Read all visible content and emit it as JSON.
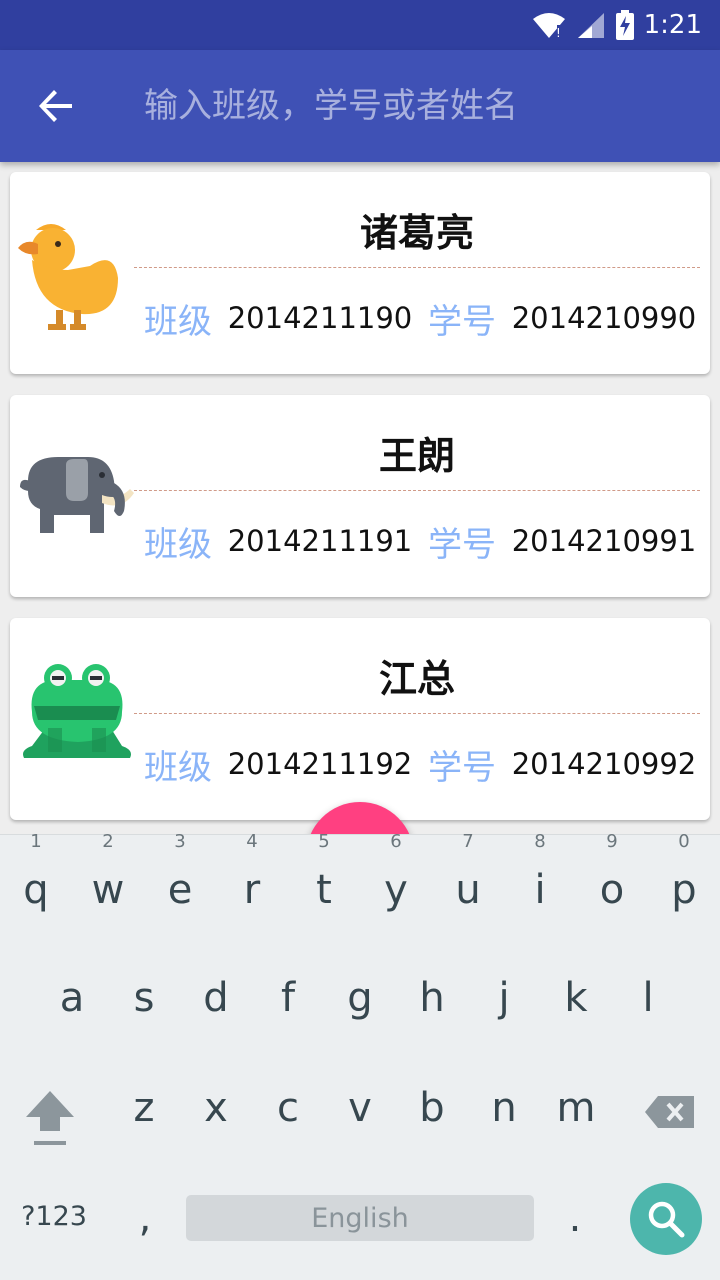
{
  "status_bar": {
    "time": "1:21",
    "icons": [
      "wifi-icon",
      "signal-icon",
      "battery-charging-icon"
    ]
  },
  "app_bar": {
    "back_icon": "arrow-back-icon",
    "search_placeholder": "输入班级，学号或者姓名"
  },
  "students": [
    {
      "name": "诸葛亮",
      "class_label": "班级",
      "class_value": "2014211190",
      "id_label": "学号",
      "id_value": "2014210990",
      "avatar": "duck-icon"
    },
    {
      "name": "王朗",
      "class_label": "班级",
      "class_value": "2014211191",
      "id_label": "学号",
      "id_value": "2014210991",
      "avatar": "elephant-icon"
    },
    {
      "name": "江总",
      "class_label": "班级",
      "class_value": "2014211192",
      "id_label": "学号",
      "id_value": "2014210992",
      "avatar": "frog-icon"
    }
  ],
  "fab": {
    "color": "#ff4081"
  },
  "keyboard": {
    "row1": [
      "q",
      "w",
      "e",
      "r",
      "t",
      "y",
      "u",
      "i",
      "o",
      "p"
    ],
    "row1_hints": [
      "1",
      "2",
      "3",
      "4",
      "5",
      "6",
      "7",
      "8",
      "9",
      "0"
    ],
    "row2": [
      "a",
      "s",
      "d",
      "f",
      "g",
      "h",
      "j",
      "k",
      "l"
    ],
    "row3": [
      "z",
      "x",
      "c",
      "v",
      "b",
      "n",
      "m"
    ],
    "symbols_key": "?123",
    "comma_key": ",",
    "space_label": "English",
    "period_key": ".",
    "action_icon": "search-icon"
  },
  "colors": {
    "status_bar": "#303f9f",
    "app_bar": "#3f51b5",
    "label_blue": "#8ab4f8",
    "action_key": "#4db6ac"
  }
}
